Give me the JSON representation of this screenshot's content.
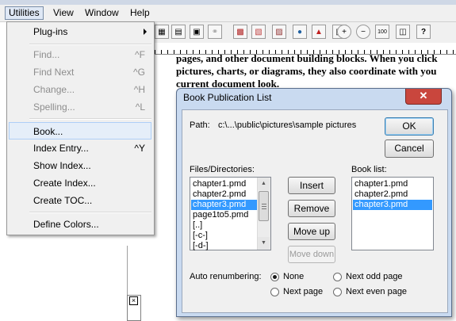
{
  "menubar": {
    "items": [
      "Utilities",
      "View",
      "Window",
      "Help"
    ]
  },
  "document_text": {
    "lines": [
      "pages, and other document building blocks. When you click",
      "pictures, charts, or diagrams, they also coordinate with you",
      "current document look."
    ]
  },
  "dropdown": {
    "items": [
      {
        "label": "Plug-ins",
        "shortcut": "",
        "state": "submenu"
      },
      {
        "label": "Find...",
        "shortcut": "^F",
        "state": "disabled"
      },
      {
        "label": "Find Next",
        "shortcut": "^G",
        "state": "disabled"
      },
      {
        "label": "Change...",
        "shortcut": "^H",
        "state": "disabled"
      },
      {
        "label": "Spelling...",
        "shortcut": "^L",
        "state": "disabled"
      },
      {
        "label": "Book...",
        "shortcut": "",
        "state": "highlighted"
      },
      {
        "label": "Index Entry...",
        "shortcut": "^Y",
        "state": "enabled"
      },
      {
        "label": "Show Index...",
        "shortcut": "",
        "state": "enabled"
      },
      {
        "label": "Create Index...",
        "shortcut": "",
        "state": "enabled"
      },
      {
        "label": "Create TOC...",
        "shortcut": "",
        "state": "enabled"
      },
      {
        "label": "Define Colors...",
        "shortcut": "",
        "state": "enabled"
      }
    ]
  },
  "dialog": {
    "title": "Book Publication List",
    "close_glyph": "✕",
    "path_label": "Path:",
    "path_value": "c:\\...\\public\\pictures\\sample pictures",
    "ok_label": "OK",
    "cancel_label": "Cancel",
    "files_label": "Files/Directories:",
    "files": [
      "chapter1.pmd",
      "chapter2.pmd",
      "chapter3.pmd",
      "page1to5.pmd",
      "[..]",
      "[-c-]",
      "[-d-]"
    ],
    "files_selected": "chapter3.pmd",
    "book_label": "Book list:",
    "book": [
      "chapter1.pmd",
      "chapter2.pmd",
      "chapter3.pmd"
    ],
    "book_selected": "chapter3.pmd",
    "insert_label": "Insert",
    "remove_label": "Remove",
    "moveup_label": "Move up",
    "movedown_label": "Move down",
    "renumber_label": "Auto renumbering:",
    "radios": [
      {
        "label": "None",
        "checked": true
      },
      {
        "label": "Next odd page",
        "checked": false
      },
      {
        "label": "Next page",
        "checked": false
      },
      {
        "label": "Next even page",
        "checked": false
      }
    ]
  },
  "colors": {
    "selection": "#3399ff",
    "dialog_frame": "#c9daf0",
    "close_button": "#c9463d",
    "menu_highlight": "#e5eef9"
  }
}
